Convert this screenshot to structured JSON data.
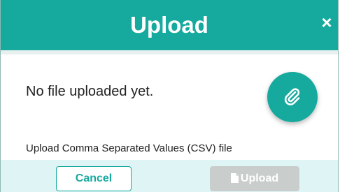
{
  "modal": {
    "title": "Upload",
    "close_label": "×"
  },
  "body": {
    "empty_message": "No file uploaded yet.",
    "hint": "Upload Comma Separated Values (CSV) file"
  },
  "footer": {
    "cancel_label": "Cancel",
    "upload_label": "Upload"
  },
  "icons": {
    "attach": "paperclip-icon",
    "upload_file": "file-icon"
  },
  "colors": {
    "accent": "#16a99e",
    "footer_bg": "#dff5f5",
    "disabled_button": "#c9cecd"
  }
}
